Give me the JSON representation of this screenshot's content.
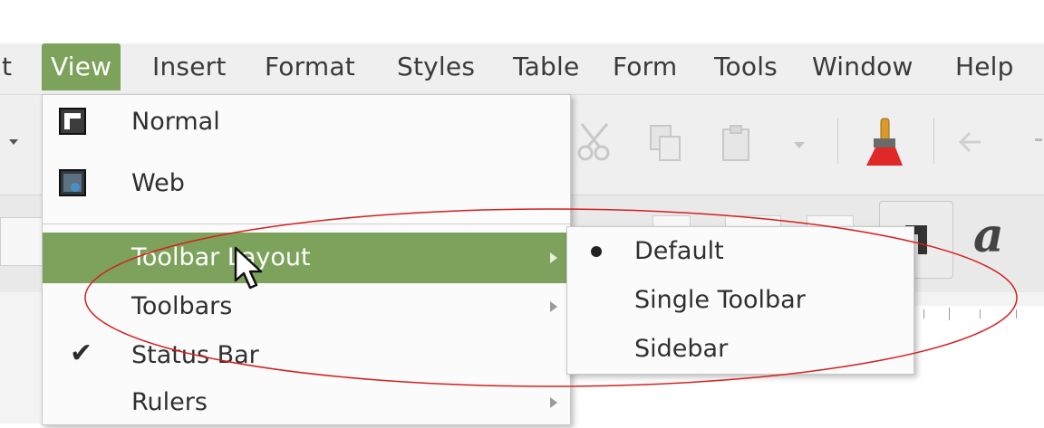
{
  "menubar": {
    "items": [
      {
        "label": "t"
      },
      {
        "label": "View"
      },
      {
        "label": "Insert"
      },
      {
        "label": "Format"
      },
      {
        "label": "Styles"
      },
      {
        "label": "Table"
      },
      {
        "label": "Form"
      },
      {
        "label": "Tools"
      },
      {
        "label": "Window"
      },
      {
        "label": "Help"
      }
    ]
  },
  "view_menu": {
    "items": [
      {
        "label": "Normal",
        "icon": "normal-view-icon"
      },
      {
        "label": "Web",
        "icon": "web-view-icon"
      },
      {
        "label": "Toolbar Layout",
        "submenu": true,
        "highlighted": true
      },
      {
        "label": "Toolbars",
        "submenu": true
      },
      {
        "label": "Status Bar",
        "checked": true
      },
      {
        "label": "Rulers",
        "submenu": true
      }
    ]
  },
  "toolbar_layout_submenu": {
    "items": [
      {
        "label": "Default",
        "selected": true
      },
      {
        "label": "Single Toolbar"
      },
      {
        "label": "Sidebar"
      }
    ]
  },
  "toolbar": {
    "font_icon_glyph": "a"
  },
  "colors": {
    "highlight": "#7ca25b",
    "annotation": "#d42020"
  }
}
